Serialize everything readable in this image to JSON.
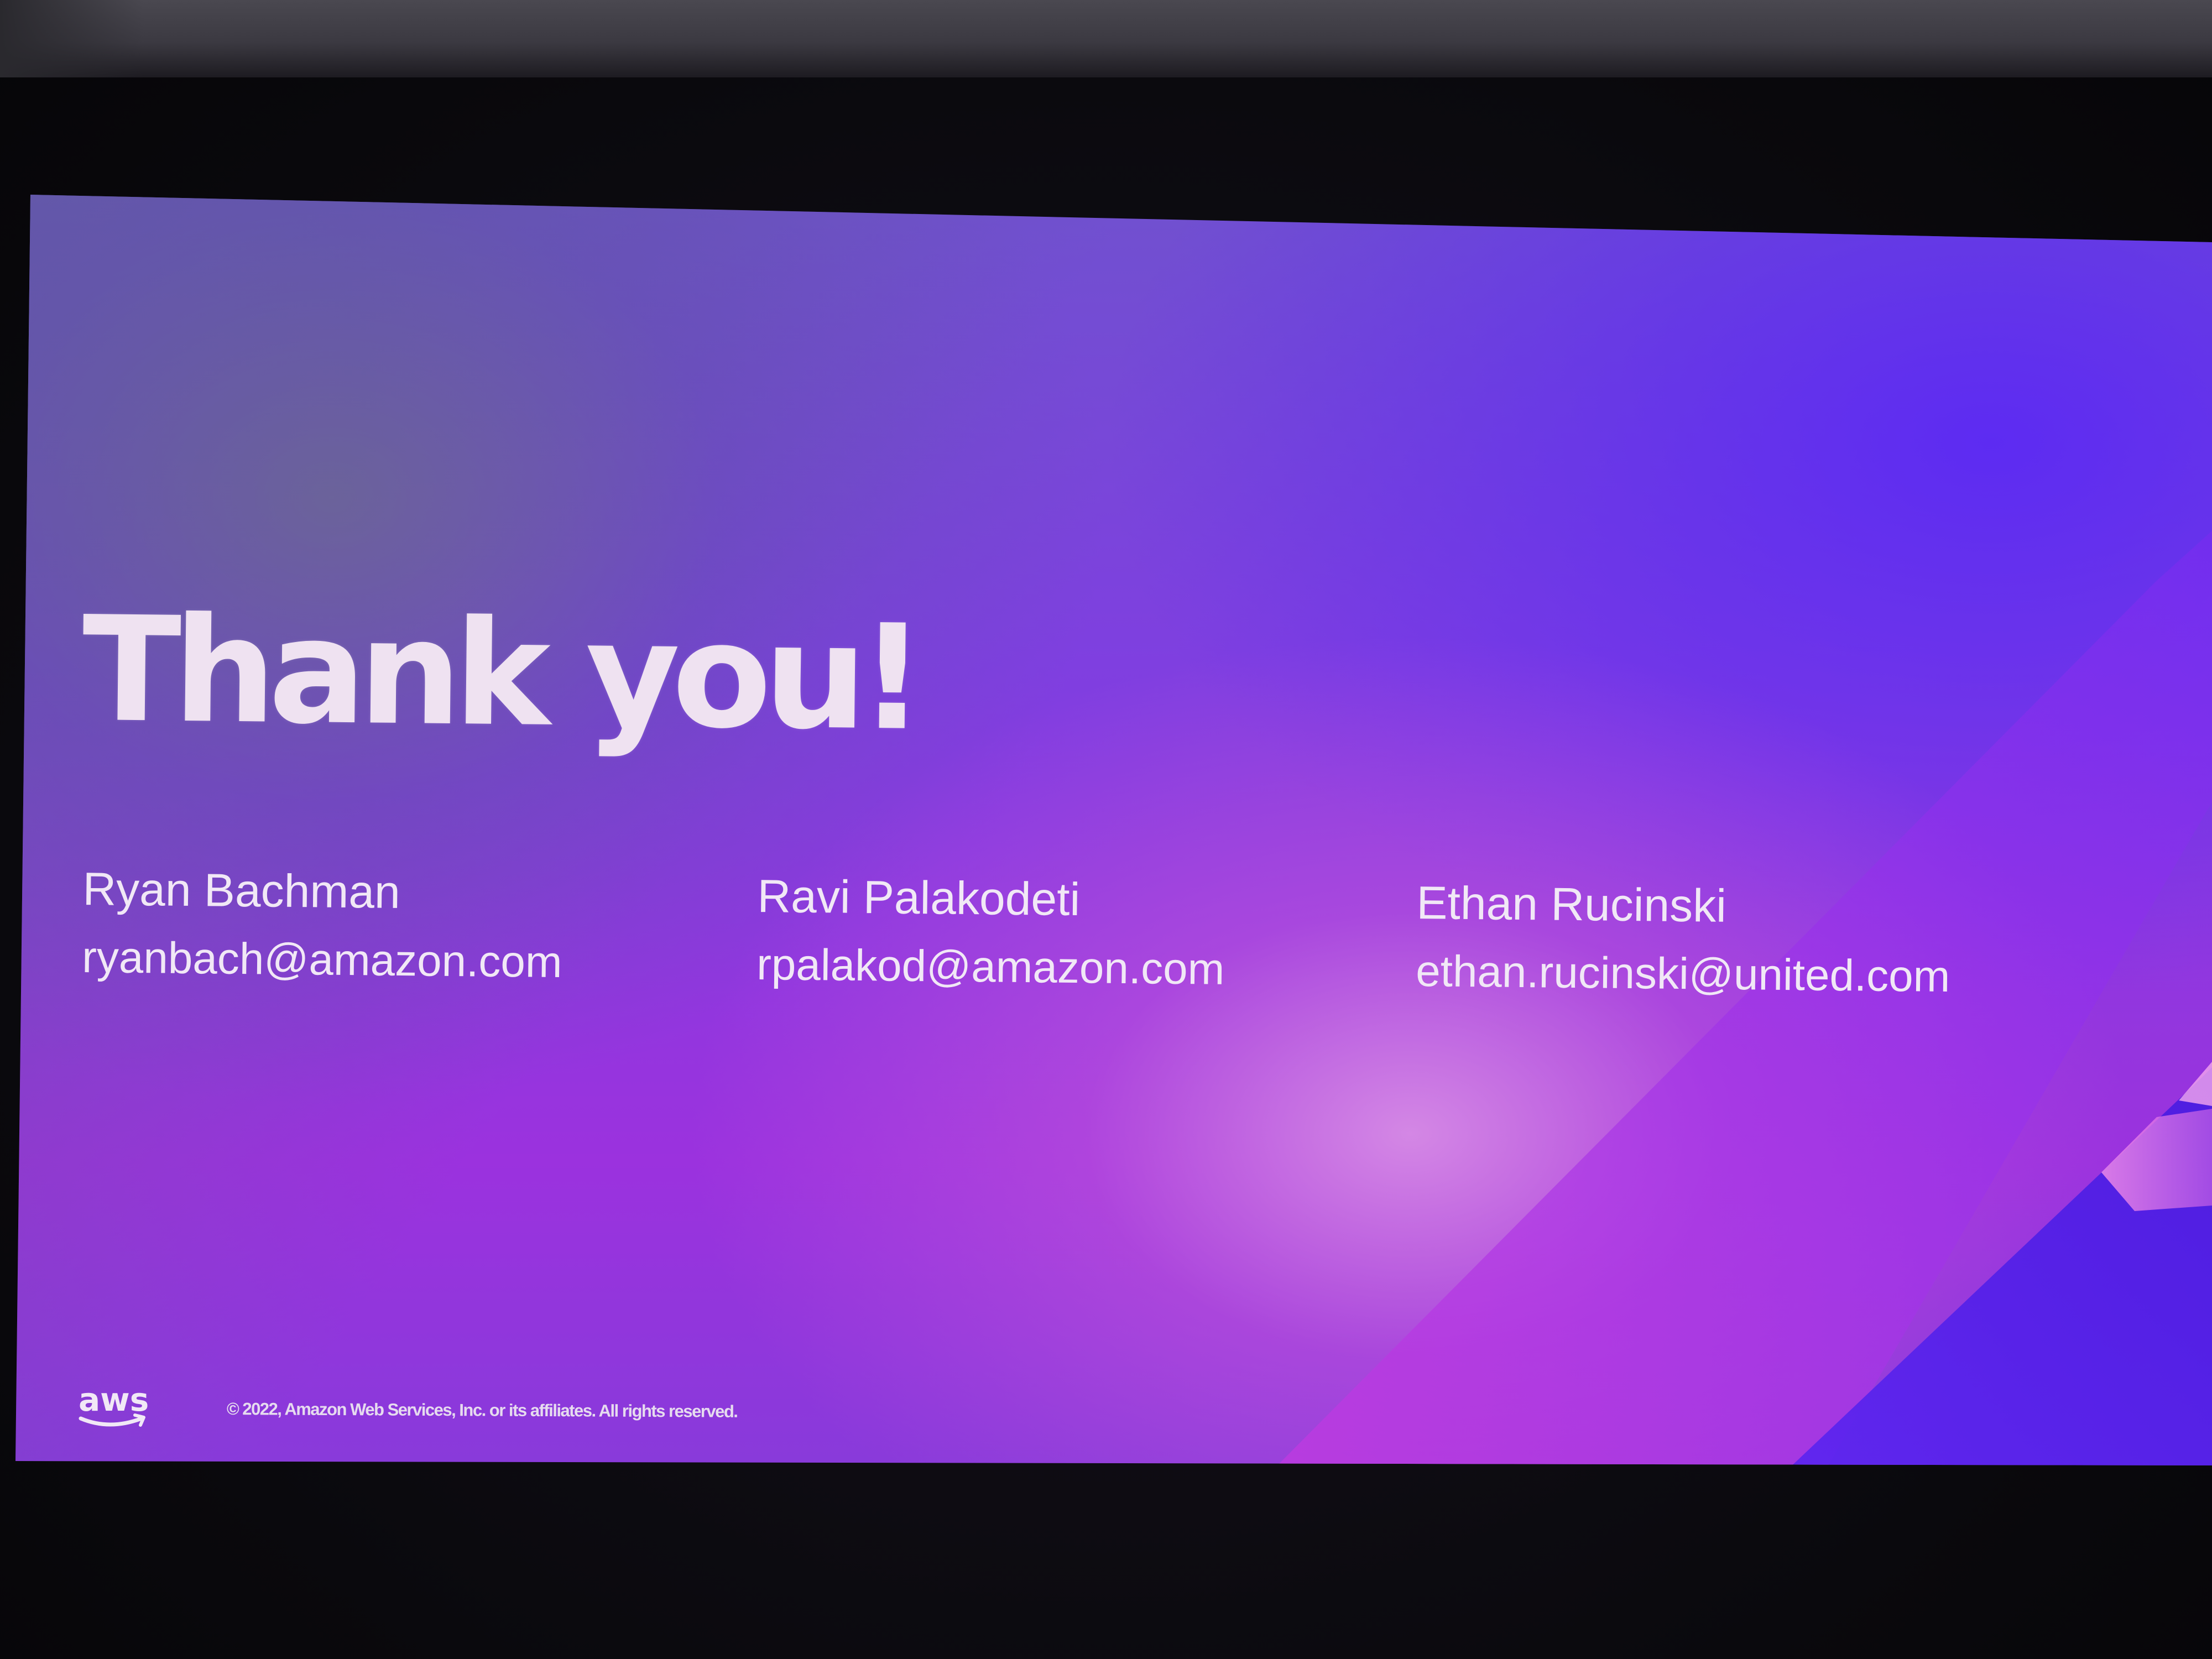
{
  "slide": {
    "title": "Thank you!",
    "contacts": [
      {
        "name": "Ryan Bachman",
        "email": "ryanbach@amazon.com"
      },
      {
        "name": "Ravi Palakodeti",
        "email": "rpalakod@amazon.com"
      },
      {
        "name": "Ethan Rucinski",
        "email": "ethan.rucinski@united.com"
      }
    ],
    "footer": {
      "logo_text": "aws",
      "copyright": "© 2022, Amazon Web Services, Inc. or its affiliates. All rights reserved."
    }
  },
  "colors": {
    "slide_base": "#8a3ae0",
    "slide_blue": "#5a28f5",
    "slide_pink_glow": "#de96e6",
    "text": "#f1e8f6",
    "background": "#0b0a10"
  }
}
